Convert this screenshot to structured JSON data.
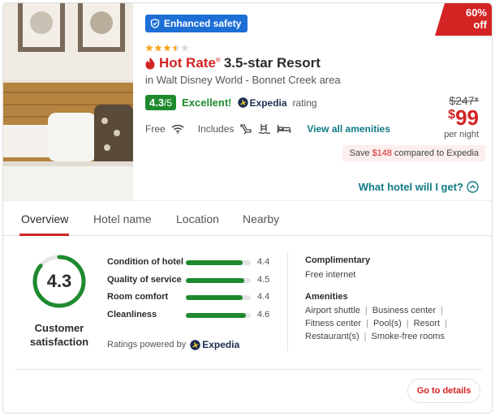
{
  "badge": {
    "discount": "60%",
    "discount_suffix": "off"
  },
  "safety": {
    "label": "Enhanced safety"
  },
  "hotel": {
    "stars": 3.5,
    "hot_rate": "Hot Rate",
    "hot_rate_mark": "®",
    "title": "3.5-star Resort",
    "location": "in Walt Disney World - Bonnet Creek area"
  },
  "rating": {
    "score": "4.3",
    "denominator": "/5",
    "word": "Excellent!",
    "provider": "Expedia",
    "suffix": "rating"
  },
  "amenities_row": {
    "free_label": "Free",
    "includes_label": "Includes",
    "link": "View all amenities"
  },
  "pricing": {
    "old_price": "$247*",
    "currency": "$",
    "price": "99",
    "per_night": "per night",
    "save_prefix": "Save",
    "save_amount": "$148",
    "save_suffix": "compared to Expedia"
  },
  "what_hotel": {
    "label": "What hotel will I get?"
  },
  "tabs": [
    {
      "label": "Overview",
      "active": true
    },
    {
      "label": "Hotel name",
      "active": false
    },
    {
      "label": "Location",
      "active": false
    },
    {
      "label": "Nearby",
      "active": false
    }
  ],
  "satisfaction": {
    "score": "4.3",
    "score_fraction": 0.86,
    "label_line1": "Customer",
    "label_line2": "satisfaction"
  },
  "metrics": [
    {
      "label": "Condition of hotel",
      "value": "4.4",
      "fraction": 0.88
    },
    {
      "label": "Quality of service",
      "value": "4.5",
      "fraction": 0.9
    },
    {
      "label": "Room comfort",
      "value": "4.4",
      "fraction": 0.88
    },
    {
      "label": "Cleanliness",
      "value": "4.6",
      "fraction": 0.92
    }
  ],
  "powered": {
    "prefix": "Ratings powered by",
    "provider": "Expedia"
  },
  "complimentary": {
    "title": "Complimentary",
    "items": [
      "Free internet"
    ]
  },
  "amenities": {
    "title": "Amenities",
    "lines": [
      [
        "Airport shuttle",
        "Business center"
      ],
      [
        "Fitness center",
        "Pool(s)",
        "Resort"
      ],
      [
        "Restaurant(s)",
        "Smoke-free rooms"
      ]
    ]
  },
  "actions": {
    "details": "Go to details"
  },
  "colors": {
    "accent_red": "#d32323",
    "rating_green": "#1e8a2e",
    "link_teal": "#0f7a86",
    "safety_blue": "#1d6fd6"
  }
}
